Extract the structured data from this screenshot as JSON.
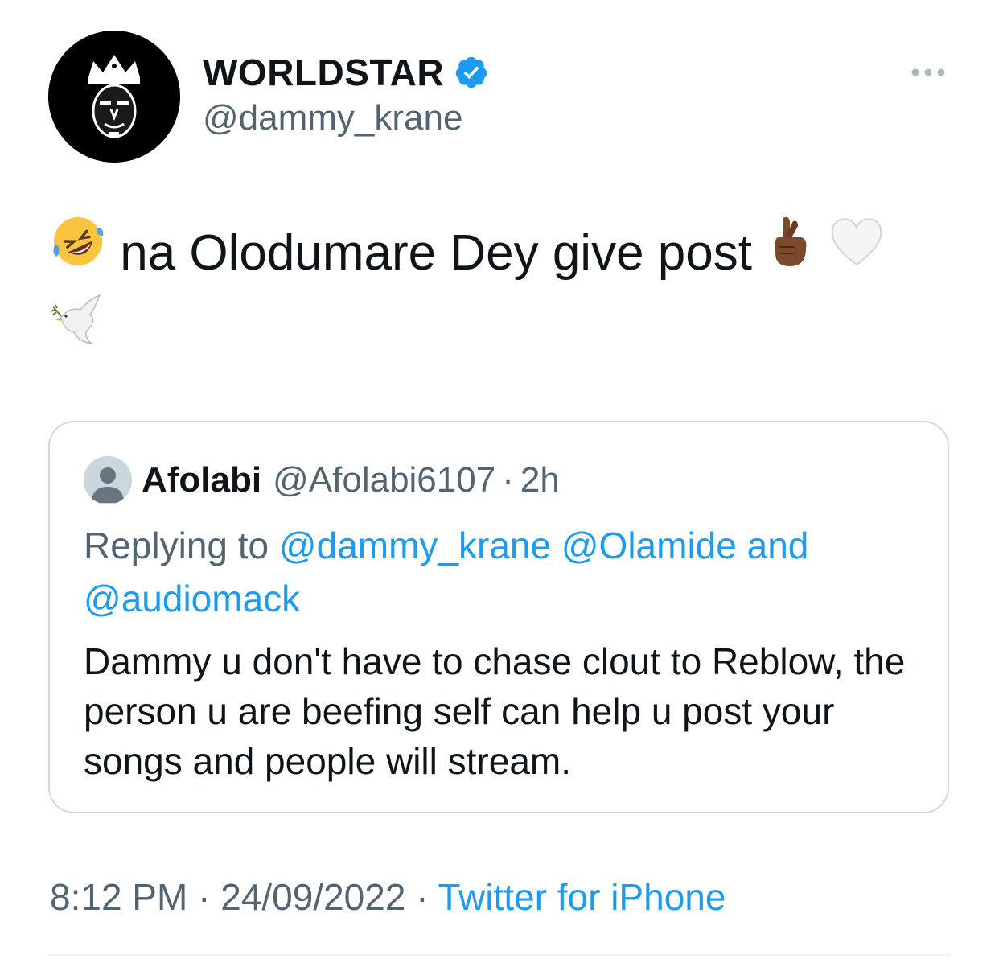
{
  "author": {
    "display_name": "WORLDSTAR",
    "handle": "@dammy_krane"
  },
  "tweet": {
    "text": "na Olodumare Dey give post",
    "emojis": [
      "rolling-on-floor-laughing",
      "crossed-fingers",
      "white-heart",
      "dove"
    ]
  },
  "quoted_tweet": {
    "name": "Afolabi",
    "handle": "@Afolabi6107",
    "separator": "·",
    "time": "2h",
    "replying_prefix": "Replying to",
    "mentions": [
      "@dammy_krane",
      "@Olamide"
    ],
    "and_text": "and",
    "last_mention": "@audiomack",
    "body": "Dammy u don't have to chase clout to Reblow, the person u are beefing self can help u post your songs and people will stream."
  },
  "meta": {
    "time": "8:12 PM",
    "separator": "·",
    "date": "24/09/2022",
    "source": "Twitter for iPhone"
  },
  "colors": {
    "text": "#0f1419",
    "secondary": "#536471",
    "link": "#1d9bf0",
    "border": "#cfd9de"
  }
}
